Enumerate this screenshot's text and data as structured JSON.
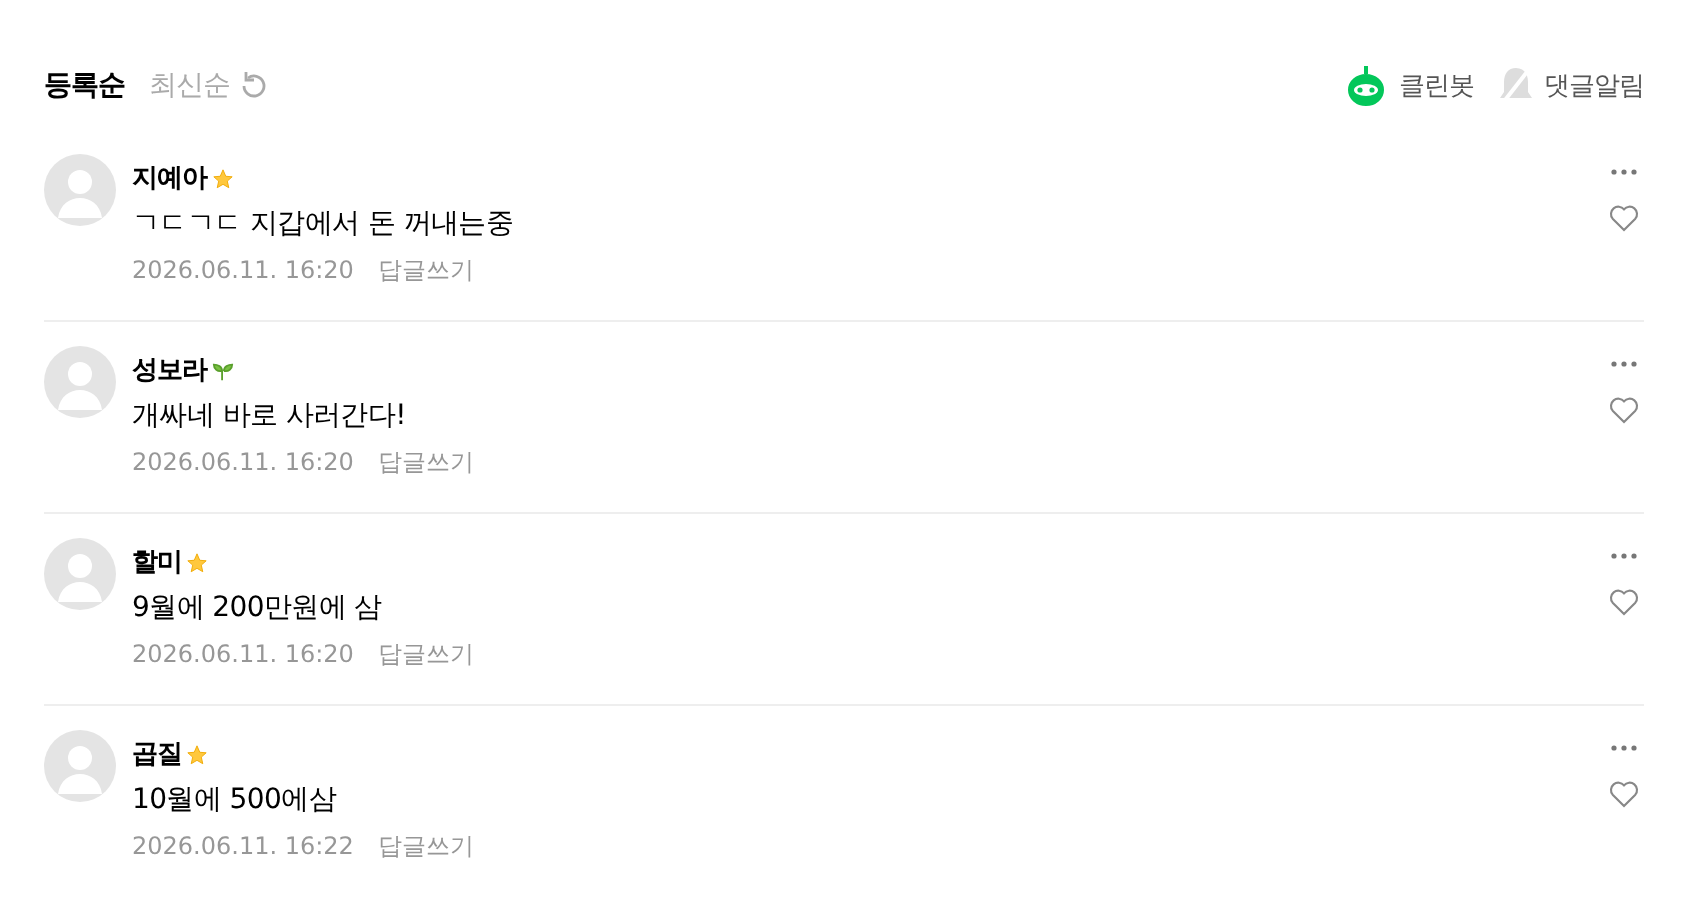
{
  "sort_tabs": [
    {
      "label": "등록순",
      "selected": true
    },
    {
      "label": "최신순",
      "selected": false
    }
  ],
  "toggles": [
    {
      "kind": "cleanbot",
      "label": "클린봇",
      "on": true
    },
    {
      "kind": "alert",
      "label": "댓글알림",
      "on": false
    }
  ],
  "comments": [
    {
      "author": "지예아",
      "badge": {
        "kind": "star"
      },
      "text": "ㄱㄷㄱㄷ 지갑에서 돈 꺼내는중",
      "date": "2026.06.11. 16:20",
      "reply": "답글쓰기"
    },
    {
      "author": "성보라",
      "badge": {
        "kind": "sprout"
      },
      "text": "개싸네 바로 사러간다!",
      "date": "2026.06.11. 16:20",
      "reply": "답글쓰기"
    },
    {
      "author": "할미",
      "badge": {
        "kind": "star"
      },
      "text": "9월에 200만원에 삼",
      "date": "2026.06.11. 16:20",
      "reply": "답글쓰기"
    },
    {
      "author": "곱질",
      "badge": {
        "kind": "star"
      },
      "text": "10월에 500에삼",
      "date": "2026.06.11. 16:22",
      "reply": "답글쓰기"
    }
  ]
}
